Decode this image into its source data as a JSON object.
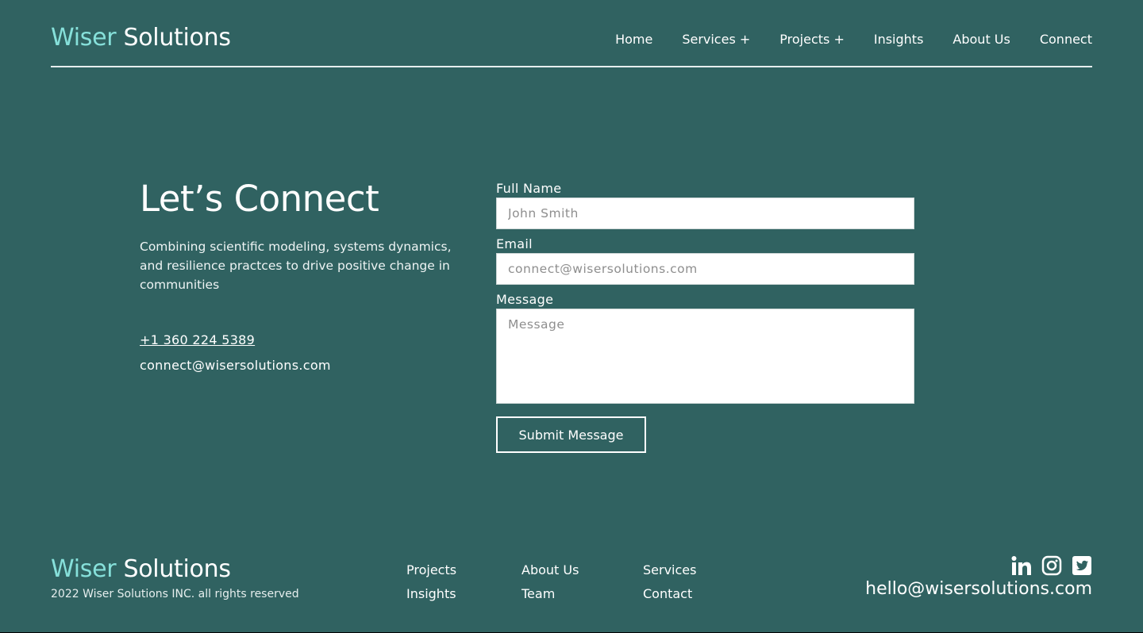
{
  "header": {
    "logo_accent": "Wiser",
    "logo_rest": " Solutions",
    "nav": [
      {
        "label": "Home"
      },
      {
        "label": "Services +"
      },
      {
        "label": "Projects +"
      },
      {
        "label": "Insights"
      },
      {
        "label": "About Us"
      },
      {
        "label": "Connect"
      }
    ]
  },
  "intro": {
    "title": "Let’s Connect",
    "description": "Combining scientific modeling, systems dynamics, and resilience practces to drive positive change in communities",
    "phone": "+1 360 224 5389",
    "email": "connect@wisersolutions.com"
  },
  "form": {
    "name_label": "Full Name",
    "name_placeholder": "John Smith",
    "email_label": "Email",
    "email_placeholder": "connect@wisersolutions.com",
    "message_label": "Message",
    "message_placeholder": "Message",
    "submit_label": "Submit Message"
  },
  "footer": {
    "logo_accent": "Wiser",
    "logo_rest": " Solutions",
    "copyright": "2022 Wiser Solutions INC. all rights reserved",
    "links": [
      "Projects",
      "Insights",
      "About Us",
      "Team",
      "Services",
      "Contact"
    ],
    "social_icons": [
      "linkedin-icon",
      "instagram-icon",
      "twitter-icon"
    ],
    "email": "hello@wisersolutions.com"
  },
  "colors": {
    "background": "#306261",
    "accent": "#86e0da",
    "text": "#ffffff"
  }
}
